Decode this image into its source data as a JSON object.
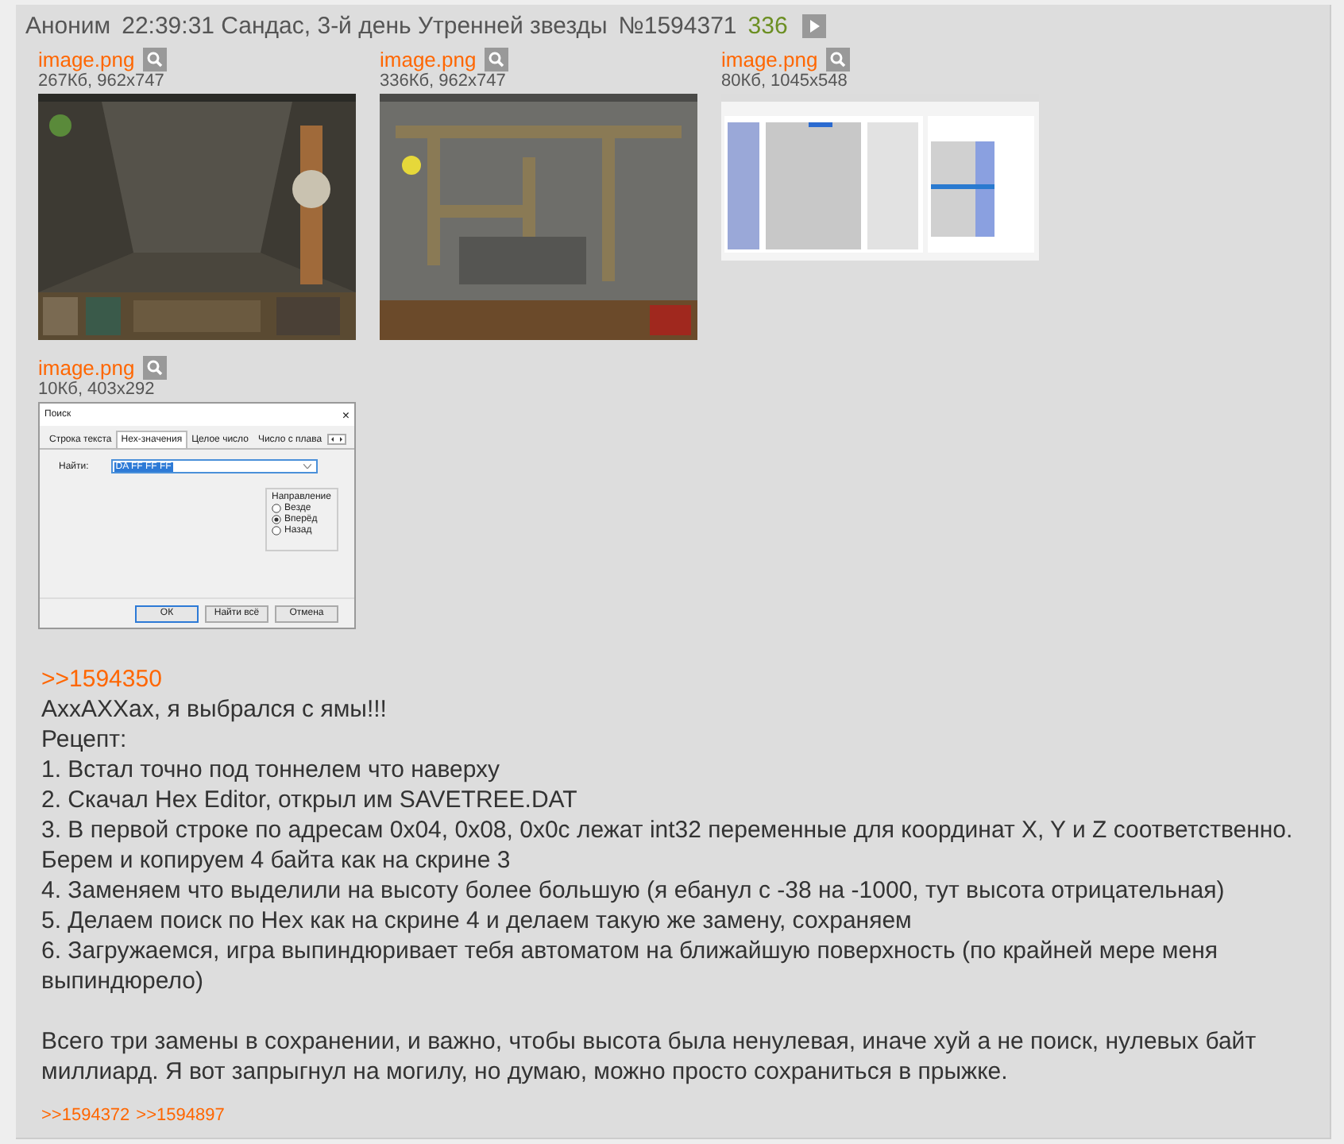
{
  "post": {
    "author": "Аноним",
    "date": "22:39:31 Сандас, 3-й день Утренней звезды",
    "number": "№1594371",
    "count": "336"
  },
  "files": [
    {
      "name": "image.png",
      "meta": "267Кб, 962x747",
      "kind": "picture"
    },
    {
      "name": "image.png",
      "meta": "336Кб, 962x747",
      "kind": "picture"
    },
    {
      "name": "image.png",
      "meta": "80Кб, 1045x548",
      "kind": "picture"
    },
    {
      "name": "image.png",
      "meta": "10Кб, 403x292",
      "kind": "dialog",
      "dialog": {
        "title": "Поиск",
        "close": "×",
        "tabs": [
          {
            "label": "Строка текста",
            "selected": false
          },
          {
            "label": "Hex-значения",
            "selected": true
          },
          {
            "label": "Целое число",
            "selected": false
          },
          {
            "label": "Число с плава",
            "selected": false
          }
        ],
        "field_label": "Найти:",
        "field_value": "DA FF FF FF",
        "group_title": "Направление",
        "options": [
          {
            "label": "Везде",
            "selected": false
          },
          {
            "label": "Вперёд",
            "selected": true
          },
          {
            "label": "Назад",
            "selected": false
          }
        ],
        "buttons": [
          "ОК",
          "Найти всё",
          "Отмена"
        ]
      }
    }
  ],
  "message": {
    "reply_link": ">>1594350",
    "paragraphs": [
      [
        "АххАХХах, я выбрался с ямы!!!",
        "Рецепт:",
        "1. Встал точно под тоннелем что наверху",
        "2. Скачал Hex Editor, открыл им SAVETREE.DAT",
        "3. В первой строке по адресам 0x04, 0x08, 0x0c лежат int32 переменные для координат X, Y и Z соответственно.",
        "Берем и копируем 4 байта как на скрине 3",
        "4. Заменяем что выделили на высоту более большую (я ебанул с -38 на -1000, тут высота отрицательная)",
        "5. Делаем поиск по Hex как на скрине 4 и делаем такую же замену, сохраняем",
        "6. Загружаемся, игра выпиндюривает тебя автоматом на ближайшую поверхность (по крайней мере меня выпиндюрело)"
      ],
      [
        "Всего три замены в сохранении, и важно, чтобы высота была ненулевая, иначе хуй а не поиск, нулевых байт миллиард. Я вот запрыгнул на могилу, но думаю, можно просто сохраниться в прыжке."
      ]
    ]
  },
  "replies": [
    ">>1594372",
    ">>1594897"
  ]
}
